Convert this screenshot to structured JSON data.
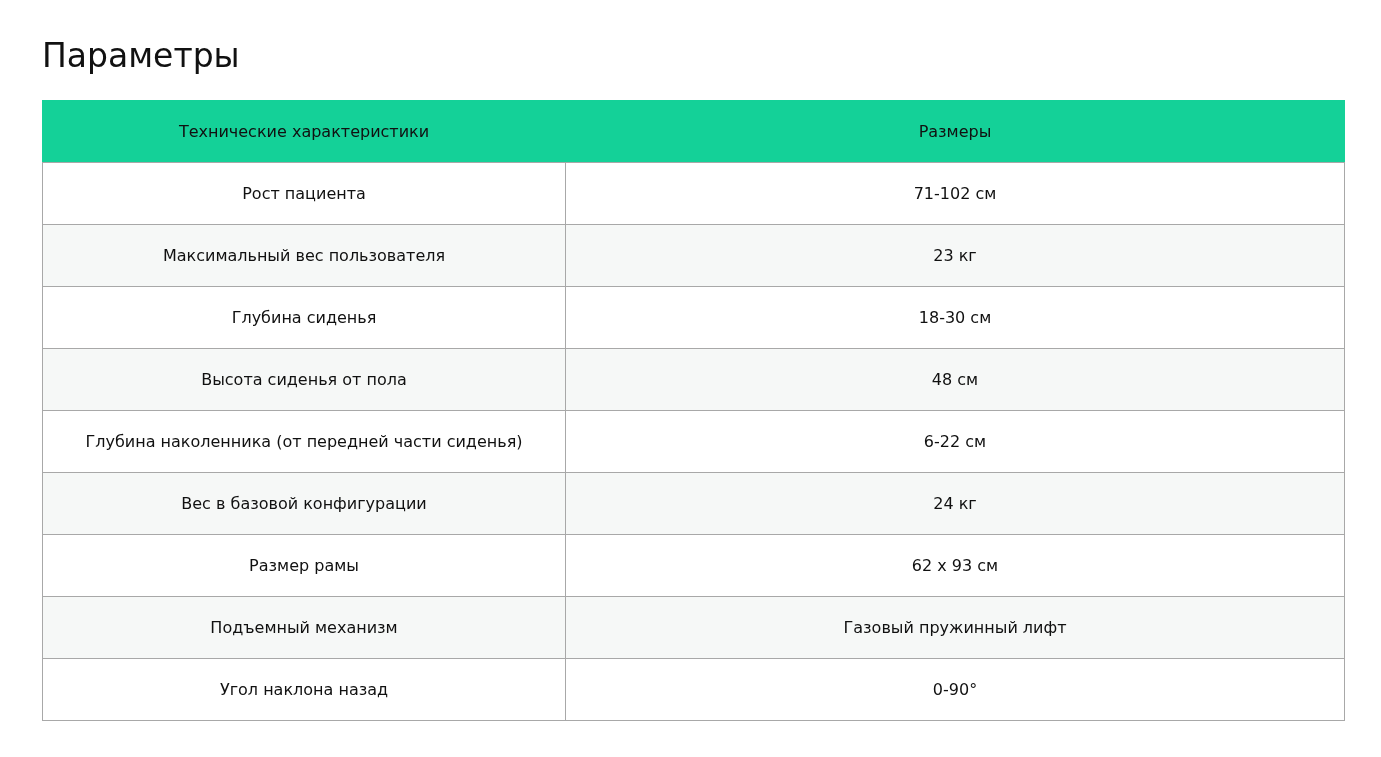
{
  "title": "Параметры",
  "table": {
    "columns": [
      "Технические характеристики",
      "Размеры"
    ],
    "rows": [
      [
        "Рост пациента",
        "71-102 см"
      ],
      [
        "Максимальный вес пользователя",
        "23 кг"
      ],
      [
        "Глубина сиденья",
        "18-30 см"
      ],
      [
        "Высота сиденья от пола",
        "48 см"
      ],
      [
        "Глубина наколенника (от передней части сиденья)",
        "6-22 см"
      ],
      [
        "Вес в базовой конфигурации",
        "24 кг"
      ],
      [
        "Размер рамы",
        "62 x 93 см"
      ],
      [
        "Подъемный механизм",
        "Газовый пружинный лифт"
      ],
      [
        "Угол наклона назад",
        "0-90°"
      ]
    ]
  }
}
